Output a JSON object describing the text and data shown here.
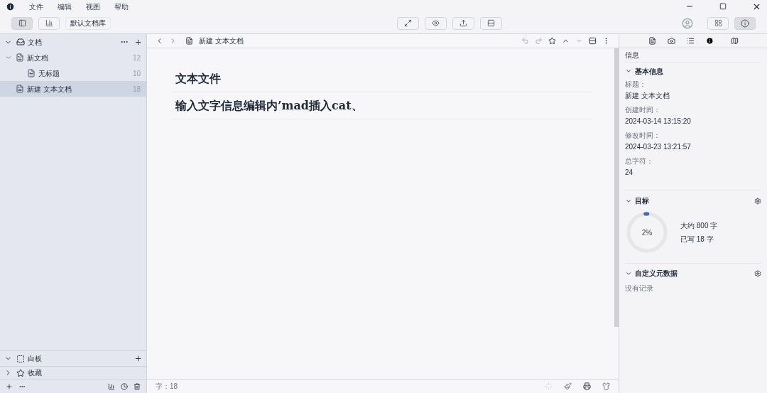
{
  "menu": [
    "文件",
    "编辑",
    "视图",
    "帮助"
  ],
  "toolbar": {
    "library_button": "默认文档库"
  },
  "sidebar": {
    "sections": [
      {
        "label": "文档",
        "kind": "docs",
        "expanded": true,
        "items": [
          {
            "label": "新文档",
            "count": "12",
            "expanded": true,
            "selected": false,
            "children": [
              {
                "label": "无标题",
                "count": "10",
                "selected": false
              }
            ]
          },
          {
            "label": "新建 文本文档",
            "count": "18",
            "selected": true
          }
        ]
      }
    ],
    "whiteboard": {
      "label": "白板",
      "expanded": true
    },
    "favorites": {
      "label": "收藏",
      "expanded": false
    }
  },
  "editor": {
    "breadcrumb": "新建 文本文档",
    "lines": [
      "文本文件",
      "输入文字信息编辑内’mad插入cat、"
    ],
    "status": "字：18"
  },
  "info": {
    "title": "信息",
    "basic": {
      "heading": "基本信息",
      "fields": [
        {
          "label": "标题：",
          "value": "新建 文本文档"
        },
        {
          "label": "创建时间：",
          "value": "2024-03-14 13:15:20"
        },
        {
          "label": "修改时间：",
          "value": "2024-03-23 13:21:57"
        },
        {
          "label": "总字符：",
          "value": "24"
        }
      ]
    },
    "goal": {
      "heading": "目标",
      "percent": "2%",
      "level": 0.02,
      "target": "大约 800 字",
      "written": "已写 18 字"
    },
    "meta": {
      "heading": "自定义元数据",
      "empty": "没有记录"
    }
  }
}
